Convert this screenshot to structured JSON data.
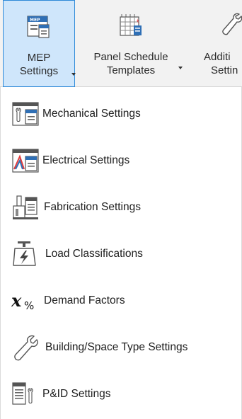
{
  "ribbon": {
    "buttons": [
      {
        "label_line1": "MEP",
        "label_line2": "Settings",
        "icon": "mep-settings-icon",
        "active": true,
        "has_dropdown": true
      },
      {
        "label_line1": "Panel Schedule",
        "label_line2": "Templates",
        "icon": "panel-schedule-icon",
        "active": false,
        "has_dropdown": true
      },
      {
        "label_line1": "Additi",
        "label_line2": "Settin",
        "icon": "wrench-icon",
        "active": false,
        "has_dropdown": false
      }
    ]
  },
  "menu": {
    "items": [
      {
        "label": "Mechanical Settings",
        "icon": "mechanical-settings-icon"
      },
      {
        "label": "Electrical Settings",
        "icon": "electrical-settings-icon"
      },
      {
        "label": "Fabrication Settings",
        "icon": "fabrication-settings-icon"
      },
      {
        "label": "Load Classifications",
        "icon": "load-classifications-icon"
      },
      {
        "label": "Demand Factors",
        "icon": "demand-factors-icon"
      },
      {
        "label": "Building/Space Type Settings",
        "icon": "wrench-icon"
      },
      {
        "label": "P&ID Settings",
        "icon": "pid-settings-icon"
      }
    ]
  },
  "colors": {
    "ribbon_bg": "#f2f2f2",
    "active_bg": "#cfe6fb",
    "active_border": "#2f8ad8",
    "icon_blue": "#2f6fb5"
  }
}
